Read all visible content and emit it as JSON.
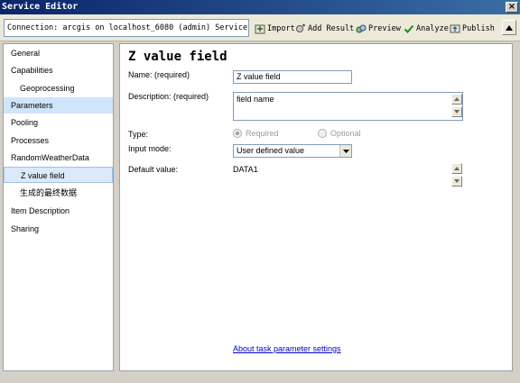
{
  "window": {
    "title": "Service Editor",
    "close_glyph": "×"
  },
  "toolbar": {
    "connection": "Connection: arcgis on localhost_6080 (admin)   Service ...",
    "import_label": "Import",
    "add_result_label": "Add Result",
    "preview_label": "Preview",
    "analyze_label": "Analyze",
    "publish_label": "Publish",
    "collapse_icon": "triangle-up-icon"
  },
  "sidebar": {
    "items": [
      {
        "label": "General"
      },
      {
        "label": "Capabilities"
      },
      {
        "label": "Geoprocessing"
      },
      {
        "label": "Parameters"
      },
      {
        "label": "Pooling"
      },
      {
        "label": "Processes"
      },
      {
        "label": "RandomWeatherData"
      },
      {
        "label": "Z value field"
      },
      {
        "label": "生成的最终数据"
      },
      {
        "label": "Item Description"
      },
      {
        "label": "Sharing"
      }
    ]
  },
  "main": {
    "title": "Z value field",
    "name_label": "Name:  (required)",
    "name_value": "Z value field",
    "description_label": "Description:  (required)",
    "description_value": "field name",
    "type_label": "Type:",
    "type_required": "Required",
    "type_optional": "Optional",
    "input_mode_label": "Input mode:",
    "input_mode_value": "User defined value",
    "default_value_label": "Default value:",
    "default_value": "DATA1",
    "help_link": "About task parameter settings"
  },
  "colors": {
    "title_bar": "#0a246a",
    "selected_nav": "#cfe5fb",
    "link": "#0000cc"
  }
}
